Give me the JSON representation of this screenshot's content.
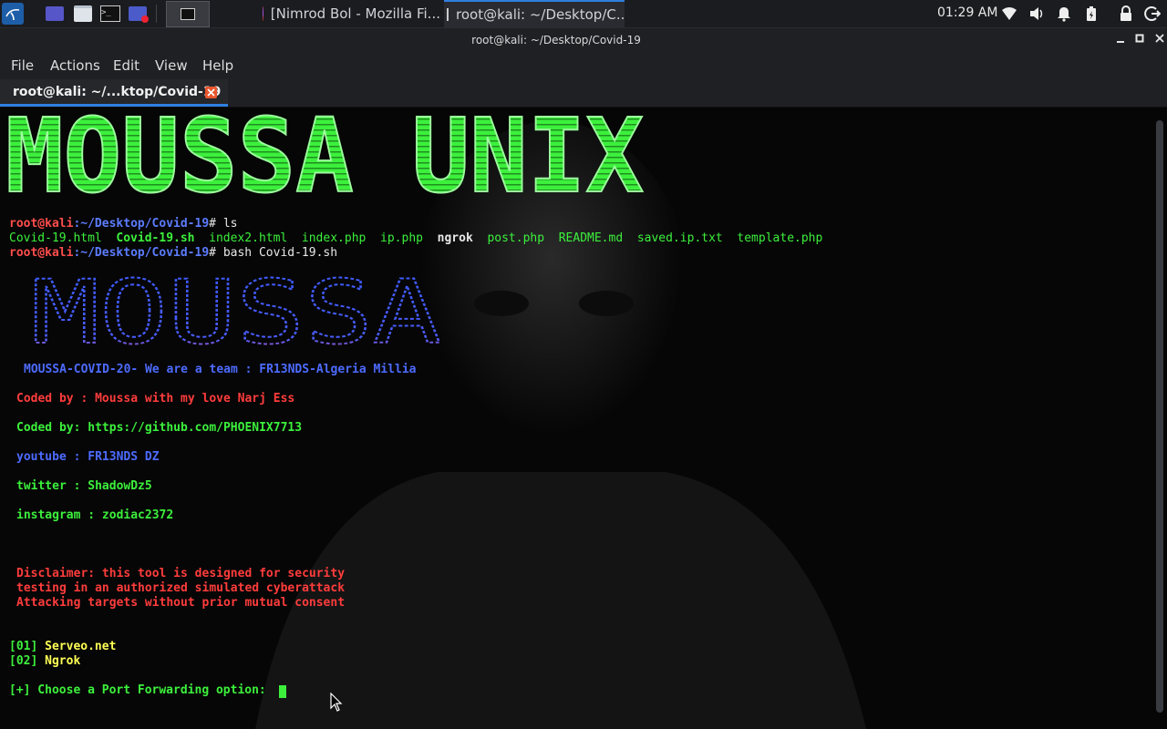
{
  "panel": {
    "tasks": [
      {
        "label": "[Nimrod Bol - Mozilla Fi..."
      },
      {
        "label": "root@kali: ~/Desktop/C..."
      }
    ],
    "clock": "01:29 AM"
  },
  "window": {
    "title": "root@kali: ~/Desktop/Covid-19",
    "menus": [
      "File",
      "Actions",
      "Edit",
      "View",
      "Help"
    ],
    "tab_label": "root@kali: ~/...ktop/Covid-19"
  },
  "terminal": {
    "banner": "MOUSSA UNIX",
    "prompt_user": "root@kali",
    "prompt_path": ":~/Desktop/Covid-19",
    "cmd1": "# ls",
    "ls": {
      "f1": "Covid-19.html",
      "f2": "Covid-19.sh",
      "f3": "index2.html",
      "f4": "index.php",
      "f5": "ip.php",
      "f6": "ngrok",
      "f7": "post.php",
      "f8": "README.md",
      "f9": "saved.ip.txt",
      "f10": "template.php"
    },
    "cmd2": "# bash Covid-19.sh",
    "ascii_logo": "MOUSSA",
    "team_line": "MOUSSA-COVID-20- We are a team : FR13NDS-Algeria Millia",
    "coded_by": "Coded by : Moussa with my love Narj Ess",
    "coded_by_gh": "Coded by: https://github.com/PHOENIX7713",
    "youtube": "youtube : FR13NDS DZ",
    "twitter": "twitter : ShadowDz5",
    "instagram": "instagram : zodiac2372",
    "disclaimer1": "Disclaimer: this tool is designed for security",
    "disclaimer2": "testing in an authorized simulated cyberattack",
    "disclaimer3": "Attacking targets without prior mutual consent",
    "opt1_num": "[01]",
    "opt1_label": "Serveo.net",
    "opt2_num": "[02]",
    "opt2_label": "Ngrok",
    "choose": "[+] Choose a Port Forwarding option: "
  }
}
